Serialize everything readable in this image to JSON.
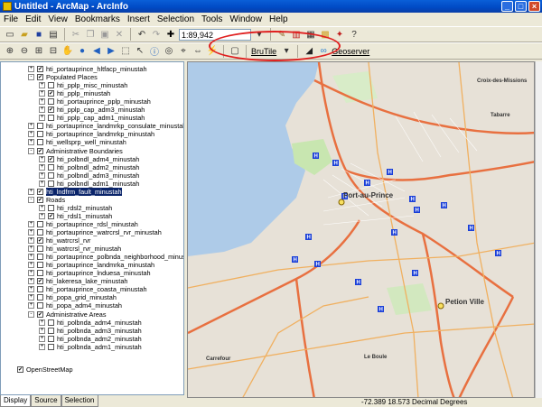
{
  "window": {
    "title": "Untitled - ArcMap - ArcInfo"
  },
  "menu": [
    "File",
    "Edit",
    "View",
    "Bookmarks",
    "Insert",
    "Selection",
    "Tools",
    "Window",
    "Help"
  ],
  "toolbar": {
    "scale": "1:89,942",
    "brutile_label": "BruTile",
    "geoserver_label": "Geoserver"
  },
  "toc": {
    "rows": [
      {
        "label": "hti_portauprince_hltfacp_minustah",
        "level": 1,
        "checked": true,
        "expander": "+"
      },
      {
        "label": "Populated Places",
        "level": 1,
        "checked": true,
        "expander": "-"
      },
      {
        "label": "hti_pplp_misc_minustah",
        "level": 2,
        "checked": false,
        "expander": "+"
      },
      {
        "label": "hti_pplp_minustah",
        "level": 2,
        "checked": true,
        "expander": "+"
      },
      {
        "label": "hti_portauprince_pplp_minustah",
        "level": 2,
        "checked": false,
        "expander": "+"
      },
      {
        "label": "hti_pplp_cap_adm3_minustah",
        "level": 2,
        "checked": true,
        "expander": "+"
      },
      {
        "label": "hti_pplp_cap_adm1_minustah",
        "level": 2,
        "checked": false,
        "expander": "+"
      },
      {
        "label": "hti_portauprince_landmrkp_consulate_minustah",
        "level": 1,
        "checked": false,
        "expander": "+"
      },
      {
        "label": "hti_portauprince_landmrkp_minustah",
        "level": 1,
        "checked": false,
        "expander": "+"
      },
      {
        "label": "hti_wellsprp_well_minustah",
        "level": 1,
        "checked": false,
        "expander": "+"
      },
      {
        "label": "Administrative Boundaries",
        "level": 1,
        "checked": true,
        "expander": "-"
      },
      {
        "label": "hti_polbndl_adm4_minustah",
        "level": 2,
        "checked": true,
        "expander": "+"
      },
      {
        "label": "hti_polbndl_adm2_minustah",
        "level": 2,
        "checked": false,
        "expander": "+"
      },
      {
        "label": "hti_polbndl_adm3_minustah",
        "level": 2,
        "checked": false,
        "expander": "+"
      },
      {
        "label": "hti_polbndl_adm1_minustah",
        "level": 2,
        "checked": false,
        "expander": "+"
      },
      {
        "label": "hti_lndfrm_fault_minustah",
        "level": 1,
        "checked": true,
        "expander": "+",
        "selected": true
      },
      {
        "label": "Roads",
        "level": 1,
        "checked": true,
        "expander": "-"
      },
      {
        "label": "hti_rdsl2_minustah",
        "level": 2,
        "checked": false,
        "expander": "+"
      },
      {
        "label": "hti_rdsl1_minustah",
        "level": 2,
        "checked": true,
        "expander": "+"
      },
      {
        "label": "hti_portauprince_rdsl_minustah",
        "level": 1,
        "checked": false,
        "expander": "+"
      },
      {
        "label": "hti_portauprince_watrcrsl_rvr_minustah",
        "level": 1,
        "checked": false,
        "expander": "+"
      },
      {
        "label": "hti_watrcrsl_rvr",
        "level": 1,
        "checked": true,
        "expander": "+"
      },
      {
        "label": "hti_watrcrsl_rvr_minustah",
        "level": 1,
        "checked": false,
        "expander": "+"
      },
      {
        "label": "hti_portauprince_polbnda_neighborhood_minustah",
        "level": 1,
        "checked": false,
        "expander": "+"
      },
      {
        "label": "hti_portauprince_landmrka_minustah",
        "level": 1,
        "checked": false,
        "expander": "+"
      },
      {
        "label": "hti_portauprince_lnduesa_minustah",
        "level": 1,
        "checked": false,
        "expander": "+"
      },
      {
        "label": "hti_lakeresa_lake_minustah",
        "level": 1,
        "checked": true,
        "expander": "+"
      },
      {
        "label": "hti_portauprince_coasta_minustah",
        "level": 1,
        "checked": false,
        "expander": "+"
      },
      {
        "label": "hti_popa_grid_minustah",
        "level": 1,
        "checked": false,
        "expander": "+"
      },
      {
        "label": "hti_popa_adm4_minustah",
        "level": 1,
        "checked": false,
        "expander": "+"
      },
      {
        "label": "Administrative Areas",
        "level": 1,
        "checked": true,
        "expander": "-"
      },
      {
        "label": "hti_polbnda_adm4_minustah",
        "level": 2,
        "checked": false,
        "expander": "+"
      },
      {
        "label": "hti_polbnda_adm3_minustah",
        "level": 2,
        "checked": false,
        "expander": "+"
      },
      {
        "label": "hti_polbnda_adm2_minustah",
        "level": 2,
        "checked": false,
        "expander": "+"
      },
      {
        "label": "hti_polbnda_adm1_minustah",
        "level": 2,
        "checked": false,
        "expander": "+"
      }
    ],
    "osm_label": "OpenStreetMap",
    "tabs": [
      "Display",
      "Source",
      "Selection"
    ]
  },
  "map": {
    "labels": [
      "Port-au-Prince",
      "Petion Ville",
      "Croix-des-Missions",
      "Carrefour",
      "Le Boule",
      "Tabarre"
    ]
  },
  "status": {
    "coords": "-72.389  18.573 Decimal Degrees"
  },
  "colors": {
    "hospital": "#1a3fd8",
    "road": "#e87040",
    "water": "#a8c6e4",
    "park": "#c8e6b0"
  }
}
